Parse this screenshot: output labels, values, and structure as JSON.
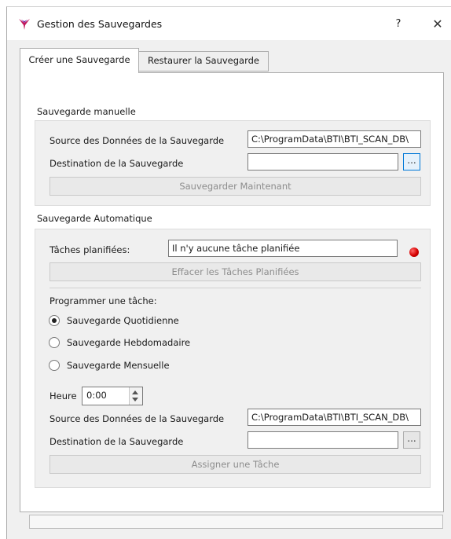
{
  "window": {
    "title": "Gestion des Sauvegardes",
    "help_label": "?",
    "close_label": "✕",
    "icon": "app-logo-icon"
  },
  "tabs": [
    {
      "label": "Créer une Sauvegarde",
      "active": true
    },
    {
      "label": "Restaurer la Sauvegarde",
      "active": false
    }
  ],
  "manual": {
    "group_title": "Sauvegarde manuelle",
    "source_label": "Source des Données de la Sauvegarde",
    "source_value": "C:\\ProgramData\\BTI\\BTI_SCAN_DB\\",
    "destination_label": "Destination de la Sauvegarde",
    "destination_value": "",
    "browse_label": "...",
    "save_now_label": "Sauvegarder Maintenant"
  },
  "automatic": {
    "group_title": "Sauvegarde Automatique",
    "scheduled_label": "Tâches planifiées:",
    "scheduled_value": "Il n'y aucune tâche planifiée",
    "status_color": "#d60000",
    "clear_label": "Effacer les Tâches Planifiées",
    "program_label": "Programmer une tâche:",
    "options": [
      {
        "label": "Sauvegarde Quotidienne",
        "selected": true
      },
      {
        "label": "Sauvegarde Hebdomadaire",
        "selected": false
      },
      {
        "label": "Sauvegarde Mensuelle",
        "selected": false
      }
    ],
    "hour_label": "Heure",
    "hour_value": "0:00",
    "source_label": "Source des Données de la Sauvegarde",
    "source_value": "C:\\ProgramData\\BTI\\BTI_SCAN_DB\\",
    "destination_label": "Destination de la Sauvegarde",
    "destination_value": "",
    "browse_label": "...",
    "assign_label": "Assigner une Tâche"
  },
  "progress": {
    "value": 0
  }
}
